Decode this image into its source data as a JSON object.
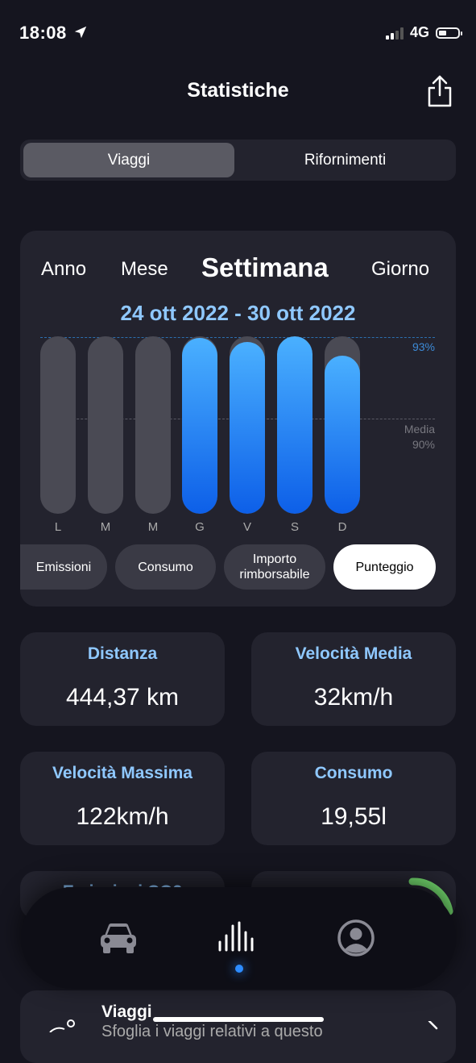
{
  "status": {
    "time": "18:08",
    "network": "4G"
  },
  "header": {
    "title": "Statistiche"
  },
  "segmented": {
    "tabs": [
      "Viaggi",
      "Rifornimenti"
    ],
    "selected": "Viaggi"
  },
  "period": {
    "tabs": [
      "Anno",
      "Mese",
      "Settimana",
      "Giorno"
    ],
    "selected": "Settimana",
    "range": "24 ott 2022 - 30 ott 2022"
  },
  "chart_data": {
    "type": "bar",
    "categories": [
      "L",
      "M",
      "M",
      "G",
      "V",
      "S",
      "D"
    ],
    "values": [
      null,
      null,
      null,
      99,
      97,
      100,
      89
    ],
    "ylim": [
      0,
      100
    ],
    "reference_lines": [
      {
        "label": "93%",
        "value": 93
      },
      {
        "label_line1": "Media",
        "label_line2": "90%",
        "value": 90
      }
    ],
    "colors": {
      "fill_top": "#4ab0ff",
      "fill_bottom": "#0d5fe8",
      "track": "#4a4a54"
    }
  },
  "metrics": {
    "chips": [
      "Emissioni",
      "Consumo",
      "Importo rimborsabile",
      "Punteggio"
    ],
    "selected": "Punteggio",
    "importo_line1": "Importo",
    "importo_line2": "rimborsabile"
  },
  "stats": {
    "distanza": {
      "label": "Distanza",
      "value": "444,37 km"
    },
    "vel_media": {
      "label": "Velocità Media",
      "value": "32km/h"
    },
    "vel_max": {
      "label": "Velocità Massima",
      "value": "122km/h"
    },
    "consumo": {
      "label": "Consumo",
      "value": "19,55l"
    },
    "emissioni_partial": {
      "label": "Emissioni CO2"
    }
  },
  "nav": {
    "items": [
      "car-icon",
      "stats-icon",
      "profile-icon"
    ],
    "active": "stats-icon"
  },
  "trips": {
    "title": "Viaggi",
    "subtitle": "Sfoglia i viaggi relativi a questo"
  },
  "colors": {
    "accent": "#8fc8ff",
    "background": "#15151f",
    "card": "#23232e"
  }
}
